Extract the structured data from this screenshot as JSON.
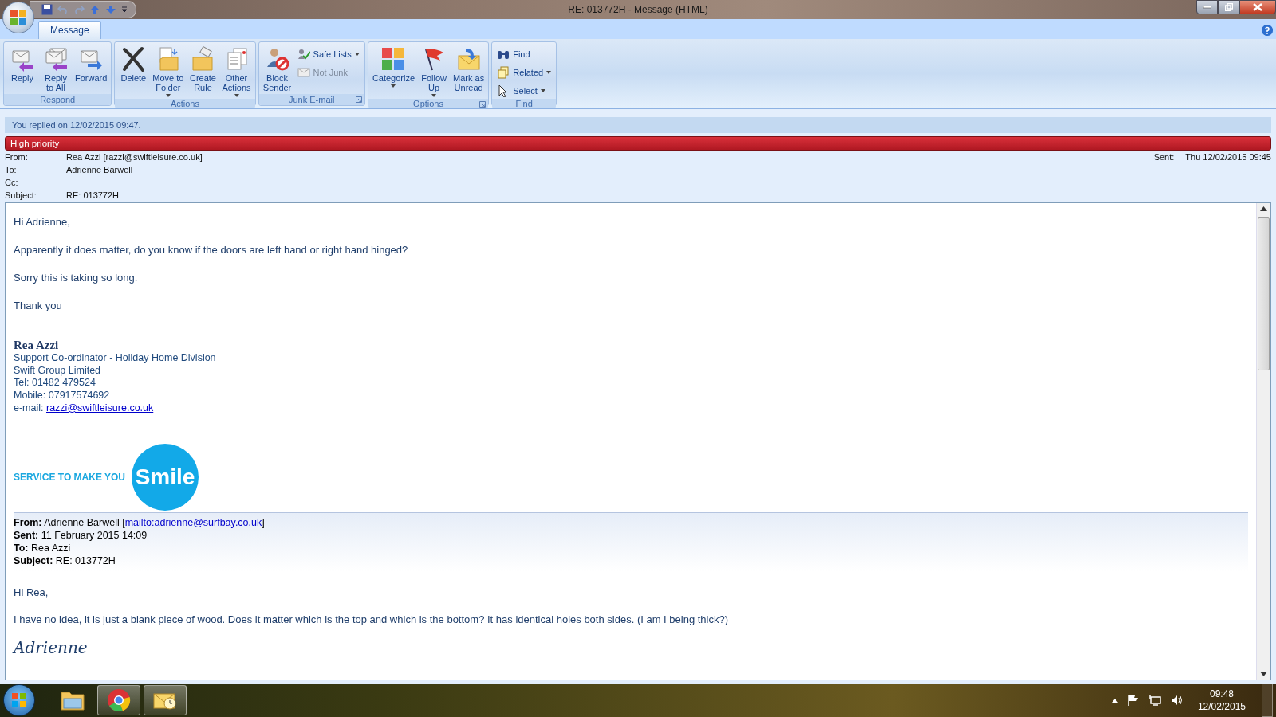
{
  "window": {
    "title": "RE: 013772H - Message (HTML)"
  },
  "tabs": [
    {
      "label": "Message",
      "selected": true
    }
  ],
  "ribbon": {
    "groups": [
      {
        "label": "Respond",
        "buttons": [
          {
            "label": "Reply",
            "kind": "large"
          },
          {
            "label": "Reply\nto All",
            "kind": "large"
          },
          {
            "label": "Forward",
            "kind": "large"
          }
        ]
      },
      {
        "label": "Actions",
        "buttons": [
          {
            "label": "Delete",
            "kind": "large"
          },
          {
            "label": "Move to\nFolder",
            "kind": "large",
            "dropdown": true
          },
          {
            "label": "Create\nRule",
            "kind": "large"
          },
          {
            "label": "Other\nActions",
            "kind": "large",
            "dropdown": true
          }
        ]
      },
      {
        "label": "Junk E-mail",
        "launcher": true,
        "buttons": [
          {
            "label": "Block\nSender",
            "kind": "large"
          },
          {
            "label": "Safe Lists",
            "kind": "small",
            "dropdown": true
          },
          {
            "label": "Not Junk",
            "kind": "small",
            "disabled": true
          }
        ]
      },
      {
        "label": "Options",
        "launcher": true,
        "buttons": [
          {
            "label": "Categorize",
            "kind": "large",
            "dropdown": true
          },
          {
            "label": "Follow\nUp",
            "kind": "large",
            "dropdown": true
          },
          {
            "label": "Mark as\nUnread",
            "kind": "large"
          }
        ]
      },
      {
        "label": "Find",
        "buttons": [
          {
            "label": "Find",
            "kind": "small"
          },
          {
            "label": "Related",
            "kind": "small",
            "dropdown": true
          },
          {
            "label": "Select",
            "kind": "small",
            "dropdown": true
          }
        ]
      }
    ]
  },
  "info_bar": "You replied on 12/02/2015 09:47.",
  "priority_bar": "High priority",
  "headers": [
    {
      "label": "From:",
      "value": "Rea Azzi [razzi@swiftleisure.co.uk]"
    },
    {
      "label": "To:",
      "value": "Adrienne Barwell"
    },
    {
      "label": "Cc:"
    },
    {
      "label": "Subject:",
      "value": "RE: 013772H"
    }
  ],
  "sent": {
    "label": "Sent:",
    "value": "Thu 12/02/2015 09:45"
  },
  "body": {
    "paragraphs": [
      "Hi Adrienne,",
      "Apparently it does matter, do you know if the doors are left hand or right hand hinged?",
      "Sorry this is taking so long.",
      "Thank you"
    ],
    "signature": {
      "name": "Rea Azzi",
      "lines": [
        "Support Co-ordinator - Holiday Home Division",
        "Swift Group Limited",
        "Tel: 01482 479524",
        "Mobile: 07917574692"
      ],
      "email_label": "e-mail:",
      "email": "razzi@swiftleisure.co.uk"
    },
    "logo": {
      "tagline": "SERVICE TO MAKE YOU",
      "word": "Smile"
    },
    "quoted": {
      "headers": [
        {
          "label": "From:",
          "value": "Adrienne Barwell [",
          "link": "mailto:adrienne@surfbay.co.uk",
          "after": "]"
        },
        {
          "label": "Sent:",
          "value": "11 February 2015 14:09"
        },
        {
          "label": "To:",
          "value": "Rea Azzi"
        },
        {
          "label": "Subject:",
          "value": "RE: 013772H"
        }
      ],
      "paragraphs": [
        "Hi Rea,",
        "I have no idea, it is just a blank piece of wood.  Does it matter which is the top and which is the bottom?  It has identical holes both sides.  (I am I being thick?)"
      ],
      "signature": "Adrienne"
    }
  },
  "taskbar": {
    "apps": [
      {
        "kind": "folder",
        "running": false
      },
      {
        "kind": "browser",
        "running": true
      },
      {
        "kind": "mail",
        "running": true
      }
    ],
    "time": "09:48",
    "date": "12/02/2015"
  }
}
